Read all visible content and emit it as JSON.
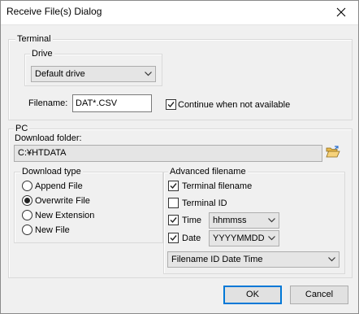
{
  "window": {
    "title": "Receive File(s) Dialog"
  },
  "terminal": {
    "group_label": "Terminal",
    "drive": {
      "group_label": "Drive",
      "selected": "Default drive"
    },
    "filename_label": "Filename:",
    "filename_value": "DAT*.CSV",
    "continue_label": "Continue when not available",
    "continue_checked": true
  },
  "pc": {
    "group_label": "PC",
    "download_folder_label": "Download folder:",
    "download_folder_value": "C:¥HTDATA"
  },
  "download_type": {
    "group_label": "Download type",
    "options": [
      "Append File",
      "Overwrite File",
      "New Extension",
      "New File"
    ],
    "selected_index": 1
  },
  "advanced": {
    "group_label": "Advanced filename",
    "terminal_filename": {
      "label": "Terminal filename",
      "checked": true
    },
    "terminal_id": {
      "label": "Terminal ID",
      "checked": false
    },
    "time": {
      "label": "Time",
      "checked": true,
      "format": "hhmmss"
    },
    "date": {
      "label": "Date",
      "checked": true,
      "format": "YYYYMMDD"
    },
    "order_selected": "Filename ID Date Time"
  },
  "buttons": {
    "ok": "OK",
    "cancel": "Cancel"
  }
}
